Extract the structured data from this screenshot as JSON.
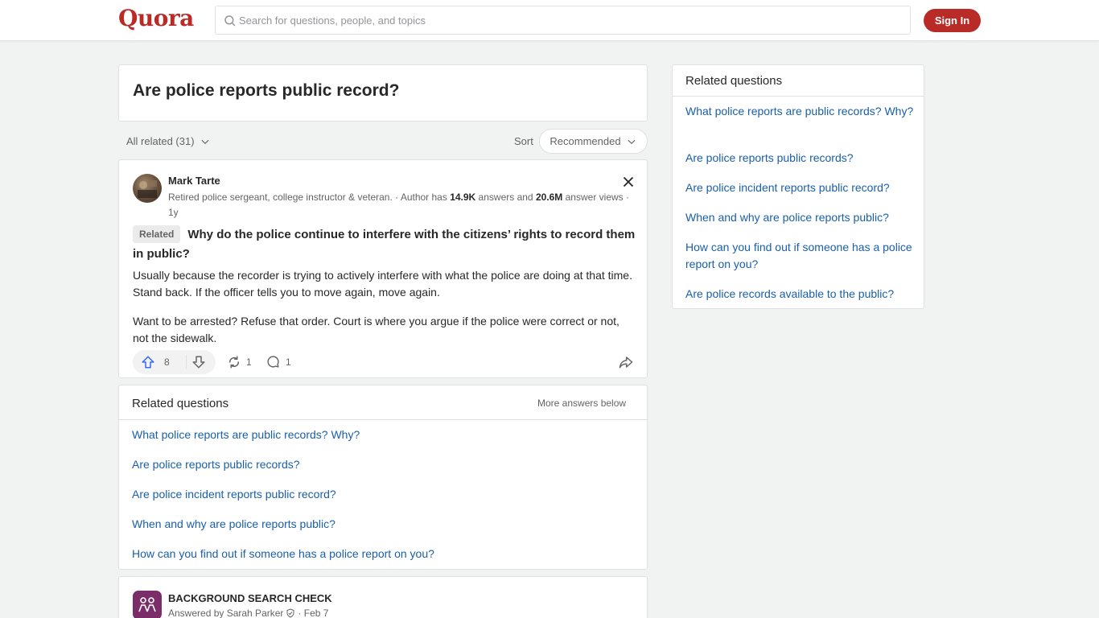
{
  "header": {
    "logo": "Quora",
    "search_placeholder": "Search for questions, people, and topics",
    "signin_label": "Sign In"
  },
  "question": {
    "title": "Are police reports public record?"
  },
  "filters": {
    "all_related": "All related (31)",
    "sort_label": "Sort",
    "sort_value": "Recommended"
  },
  "answer": {
    "author": "Mark Tarte",
    "credential": "Retired police sergeant, college instructor & veteran.",
    "stats_prefix": " · Author has ",
    "answers_count": "14.9K",
    "answers_mid": " answers and ",
    "views_count": "20.6M",
    "views_suffix": " answer views · 1y",
    "related_tag": "Related",
    "related_question": "Why do the police continue to interfere with the citizens’ rights to record them in public?",
    "paragraph1": "Usually because the recorder is trying to actively interfere with what the police are doing at that time. Stand back. If the officer tells you to move again, move again.",
    "paragraph2": "Want to be arrested? Refuse that order. Court is where you argue if the police were correct or not, not the sidewalk.",
    "upvotes": "8",
    "shares": "1",
    "comments": "1"
  },
  "related_main": {
    "title": "Related questions",
    "more": "More answers below",
    "items": [
      "What police reports are public records? Why?",
      "Are police reports public records?",
      "Are police incident reports public record?",
      "When and why are police reports public?",
      "How can you find out if someone has a police report on you?"
    ]
  },
  "second_answer": {
    "name": "BACKGROUND SEARCH CHECK",
    "answered_by": "Answered by Sarah Parker",
    "date": "· Feb 7"
  },
  "sidebar": {
    "title": "Related questions",
    "items": [
      "What police reports are public records? Why?",
      "Are police reports public records?",
      "Are police incident reports public record?",
      "When and why are police reports public?",
      "How can you find out if someone has a police report on you?",
      "Are police records available to the public?"
    ]
  },
  "colors": {
    "brand": "#b92b27",
    "link": "#195faa",
    "upvote": "#2e69ff"
  }
}
